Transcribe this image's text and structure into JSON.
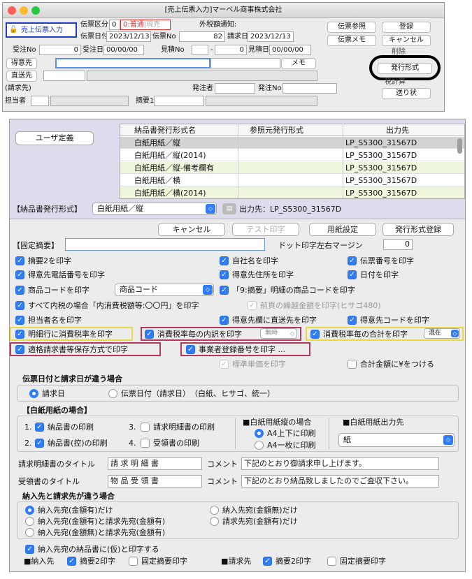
{
  "win1": {
    "title": "[売上伝票入力]マーベル商事株式会社",
    "mode_label": "売上伝票入力",
    "slip_kbn_label": "伝票区分",
    "slip_kbn_value": "0",
    "slip_kbn_text": "0:普通",
    "slip_kbn_text2": "|現売",
    "outer_tax_label": "外税額通知:",
    "slip_date_label": "伝票日付",
    "slip_date": "2023/12/13",
    "slip_no_label": "伝票No",
    "slip_no": "82",
    "bill_date_label": "請求日",
    "bill_date": "2023/12/13",
    "order_no_label": "受注No",
    "order_no": "0",
    "order_date_label": "受注日",
    "order_date": "00/00/00",
    "est_no_label": "見積No",
    "est_no_a": "-",
    "est_no": "0",
    "est_date_label": "見積日",
    "est_date": "00/00/00",
    "customer_label": "得意先",
    "direct_label": "直送先",
    "billto_label": "(請求先)",
    "person_label": "担当者",
    "orderer_label": "発注者",
    "po_label": "発注No",
    "summary1_label": "摘要1",
    "memo_btn": "メモ",
    "buttons": {
      "slip_ref": "伝票参照",
      "register": "登録",
      "slip_memo": "伝票メモ",
      "cancel": "キャンセル",
      "delete": "削除",
      "issue_format": "発行形式",
      "calc": "税計算",
      "send": "送り状"
    }
  },
  "win2": {
    "user_def": "ユーザ定義",
    "table": {
      "headers": [
        "納品書発行形式名",
        "参照元発行形式",
        "出力先"
      ],
      "rows": [
        [
          "白紙用紙／縦",
          "",
          "LP_S5300_31567D"
        ],
        [
          "白紙用紙／縦(2014)",
          "",
          "LP_S5300_31567D"
        ],
        [
          "白紙用紙／縦-備考欄有",
          "",
          "LP_S5300_31567D"
        ],
        [
          "白紙用紙／横",
          "",
          "LP_S5300_31567D"
        ],
        [
          "白紙用紙／横(2014)",
          "",
          "LP_S5300_31567D"
        ]
      ]
    },
    "format_label": "【納品書発行形式】",
    "format_value": "白紙用紙／縦",
    "output_text": "出力先：LP_S5300_31567D",
    "buttons": {
      "cancel": "キャンセル",
      "test_print": "テスト印字",
      "paper": "用紙設定",
      "register": "発行形式登録"
    },
    "fixed_summary_label": "【固定摘要】",
    "dot_margin_label": "ドット印字左右マージン",
    "dot_margin": "0",
    "checks": {
      "summary2": "摘要2を印字",
      "company": "自社名を印字",
      "slip_no": "伝票番号を印字",
      "tel": "得意先電話番号を印字",
      "address": "得意先住所を印字",
      "date": "日付を印字",
      "code": "商品コードを印字",
      "code_sel": "商品コード",
      "summary9": "「9:摘要」明細の商品コードを印字",
      "inner_tax": "すべて内税の場合「内消費税額等:〇〇円」を印字",
      "carry": "前頁の繰越金額を印字(ヒサゴ480)",
      "person": "担当者名を印字",
      "direct": "得意先欄に直送先を印字",
      "cust_code": "得意先コードを印字",
      "line_tax": "明細行に消費税率を印字",
      "tax_breakdown": "消費税率毎の内訳を印字",
      "tax_breakdown_sel": "無時",
      "tax_total": "消費税率毎の合計を印字",
      "tax_total_sel": "混在",
      "invoice": "適格請求書等保存方式で印字",
      "reg_no": "事業者登録番号を印字 ...",
      "std_price": "標準単価を印字",
      "yen": "合計金額に¥をつける"
    },
    "date_diff": {
      "title": "伝票日付と請求日が違う場合",
      "opt1": "請求日",
      "opt2": "伝票日付（請求日）　（白紙、ヒサゴ、統一）"
    },
    "blank_paper": {
      "title": "【白紙用紙の場合】",
      "n1": "1.",
      "c1": "納品書の印刷",
      "n2": "2.",
      "c2": "納品書(控)の印刷",
      "n3": "3.",
      "c3": "請求明細書の印刷",
      "n4": "4.",
      "c4": "受領書の印刷",
      "vert_title": "■白紙用紙縦の場合",
      "vert_opt1": "A4上下に印刷",
      "vert_opt2": "A4一枚に印刷",
      "dest_title": "■白紙用紙出力先",
      "dest_value": "紙"
    },
    "titles": {
      "bill_title_label": "請求明細書のタイトル",
      "bill_title": "請 求 明 細 書",
      "comment_label": "コメント",
      "bill_comment": "下記のとおり御請求申し上げます。",
      "recv_title_label": "受領書のタイトル",
      "recv_title": "物 品 受 領 書",
      "recv_comment": "下記のとおり納品致しましたのでご査収下さい。"
    },
    "dest_diff": {
      "title": "納入先と請求先が違う場合",
      "o1": "納入先宛(金額有)だけ",
      "o2": "納入先宛(金額有)と請求先宛(金額有)",
      "o3": "納入先宛(金額無)と請求先宛(金額有)",
      "o4": "納入先宛(金額無)だけ",
      "o5": "請求先宛(金額有)だけ",
      "provisional": "納入先宛の納品書に(仮)と印字する",
      "nounyu": "■納入先",
      "seikyu": "■請求先",
      "summary2": "摘要2印字",
      "fixed": "固定摘要印字"
    }
  }
}
